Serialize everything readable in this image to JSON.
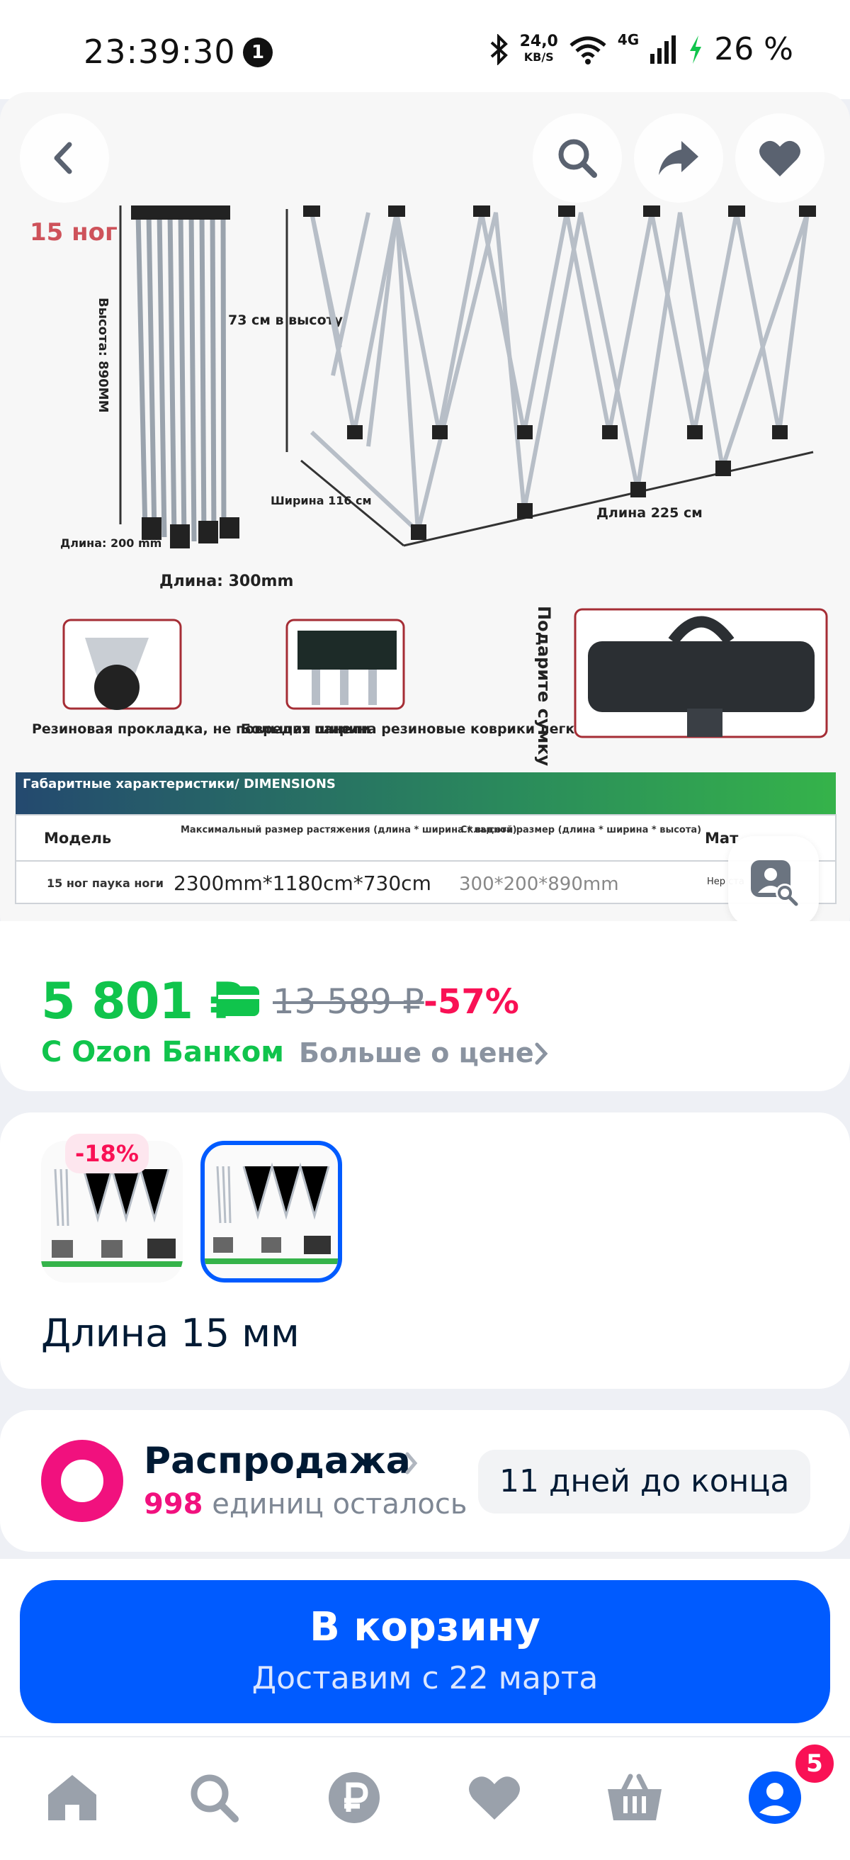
{
  "status_bar": {
    "time": "23:39:30",
    "notification_count": "1",
    "net_speed_value": "24,0",
    "net_speed_unit": "KB/S",
    "network": "4G",
    "battery": "26 %"
  },
  "image": {
    "caption": "15 ног",
    "height_label": "Высота: 890ММ",
    "height_cm_label": "73 см в высоту",
    "width_label": "Ширина 116 см",
    "length_label_225": "Длина 225 см",
    "length_200": "Длина: 200 mm",
    "length_300": "Длина: 300mm",
    "gift_bag": "Подарите сумку",
    "feature1": "Резиновая прокладка, не повредит панели",
    "feature2": "Большая ширина резиновые коврики легко нести вес",
    "table_header": "Габаритные характеристики/ DIMENSIONS",
    "col_model": "Модель",
    "col_max": "Максимальный размер растяжения (длина * ширина * высота)",
    "col_folded": "Складной размер (длина * ширина * высота)",
    "col_mat": "Мат",
    "row_model": "15 ног паука ноги",
    "row_max": "2300mm*1180cm*730cm",
    "row_folded": "300*200*890mm",
    "row_mat": "Нер ста"
  },
  "price": {
    "current": "5 801 ₽",
    "old": "13 589 ₽",
    "discount": "-57%",
    "bank_label": "С Ozon Банком",
    "more_link": "Больше о цене"
  },
  "variants": {
    "badge": "-18%",
    "label": "Длина 15 мм"
  },
  "sale": {
    "title": "Распродажа",
    "count": "998",
    "count_suffix": "единиц осталось",
    "timer": "11 дней до конца"
  },
  "cart": {
    "title": "В корзину",
    "subtitle": "Доставим с 22 марта"
  },
  "nav": {
    "profile_badge": "5"
  },
  "colors": {
    "ozon_blue": "#005bff",
    "price_green": "#10c44c",
    "discount_pink": "#f91155",
    "sale_pink": "#f1117e"
  }
}
